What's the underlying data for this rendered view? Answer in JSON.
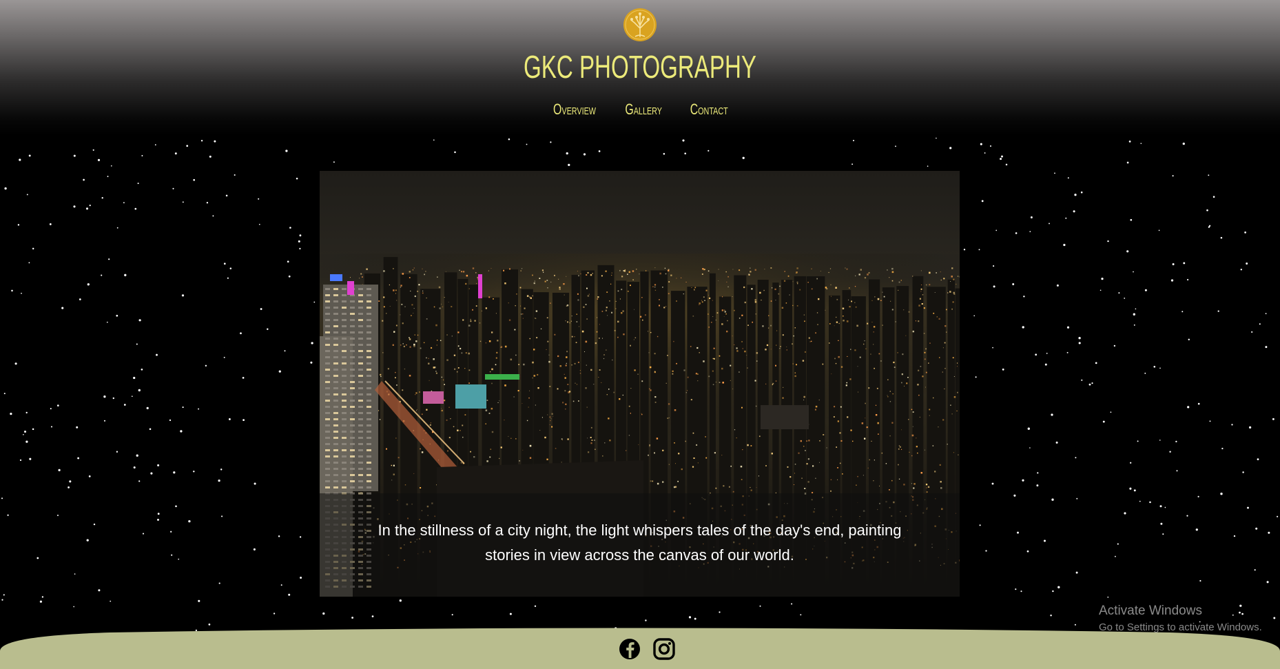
{
  "site": {
    "title": "GKC PHOTOGRAPHY",
    "logo_icon": "tree-of-life-icon",
    "accent_color": "#ecea7a",
    "logo_color": "#d9a320"
  },
  "nav": {
    "items": [
      {
        "label": "Overview"
      },
      {
        "label": "Gallery"
      },
      {
        "label": "Contact"
      }
    ]
  },
  "hero": {
    "image_subject": "city-skyline-at-night",
    "caption": "In the stillness of a city night, the light whispers tales of the day's end, painting stories in view across the canvas of our world."
  },
  "footer": {
    "social": [
      {
        "icon": "facebook-icon"
      },
      {
        "icon": "instagram-icon"
      }
    ],
    "bar_color": "#b9bd8e"
  },
  "os_overlay": {
    "title": "Activate Windows",
    "subtitle": "Go to Settings to activate Windows."
  }
}
